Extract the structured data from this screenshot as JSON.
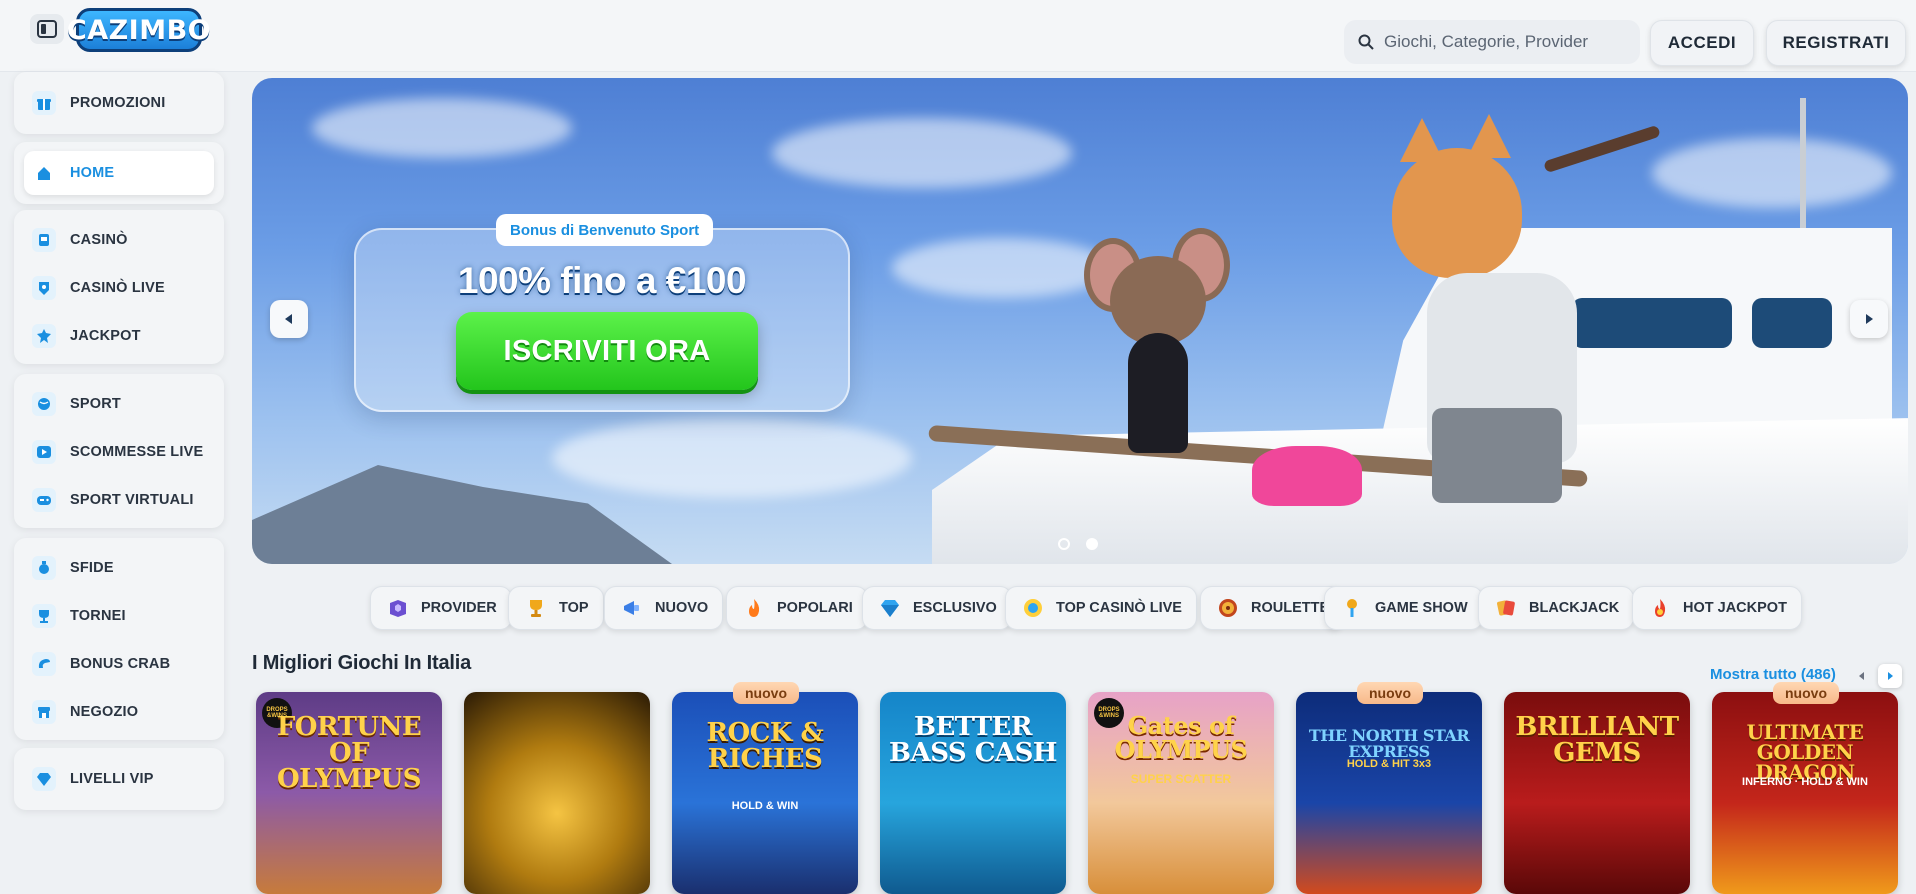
{
  "header": {
    "logo_text": "CAZIMBO",
    "search_placeholder": "Giochi, Categorie, Provider",
    "login_label": "ACCEDI",
    "register_label": "REGISTRATI"
  },
  "sidebar": {
    "groups": [
      [
        {
          "label": "PROMOZIONI",
          "icon": "gift-icon"
        }
      ],
      [
        {
          "label": "HOME",
          "icon": "home-icon",
          "active": true
        }
      ],
      [
        {
          "label": "CASINÒ",
          "icon": "slot-machine-icon"
        },
        {
          "label": "CASINÒ LIVE",
          "icon": "live-casino-icon"
        },
        {
          "label": "JACKPOT",
          "icon": "jackpot-icon"
        }
      ],
      [
        {
          "label": "SPORT",
          "icon": "ball-icon"
        },
        {
          "label": "SCOMMESSE LIVE",
          "icon": "play-icon"
        },
        {
          "label": "SPORT VIRTUALI",
          "icon": "gamepad-icon"
        }
      ],
      [
        {
          "label": "SFIDE",
          "icon": "challenge-icon"
        },
        {
          "label": "TORNEI",
          "icon": "trophy-icon"
        },
        {
          "label": "BONUS CRAB",
          "icon": "crab-icon"
        },
        {
          "label": "NEGOZIO",
          "icon": "shop-icon"
        }
      ],
      [
        {
          "label": "LIVELLI VIP",
          "icon": "diamond-icon"
        }
      ]
    ]
  },
  "hero": {
    "tag": "Bonus di Benvenuto Sport",
    "amount": "100% fino a €100",
    "cta": "ISCRIVITI ORA",
    "slides": 2,
    "active_slide": 2
  },
  "categories": [
    {
      "label": "PROVIDER",
      "icon": "provider-icon"
    },
    {
      "label": "TOP",
      "icon": "trophy-icon"
    },
    {
      "label": "NUOVO",
      "icon": "megaphone-icon"
    },
    {
      "label": "POPOLARI",
      "icon": "fire-icon"
    },
    {
      "label": "ESCLUSIVO",
      "icon": "gem-icon"
    },
    {
      "label": "TOP CASINÒ LIVE",
      "icon": "live-dealer-icon"
    },
    {
      "label": "ROULETTE",
      "icon": "roulette-icon"
    },
    {
      "label": "GAME SHOW",
      "icon": "microphone-icon"
    },
    {
      "label": "BLACKJACK",
      "icon": "cards-icon"
    },
    {
      "label": "HOT JACKPOT",
      "icon": "hot-jackpot-icon"
    }
  ],
  "games_section": {
    "title": "I Migliori Giochi In Italia",
    "see_all": "Mostra tutto (486)",
    "badge_new": "nuovo",
    "games": [
      {
        "title": "FORTUNE OF OLYMPUS",
        "new": false
      },
      {
        "title": "",
        "new": false
      },
      {
        "title": "ROCK & RICHES",
        "subtitle": "HOLD & WIN",
        "new": true
      },
      {
        "title": "BETTER BASS CASH",
        "new": false
      },
      {
        "title": "Gates of OLYMPUS",
        "subtitle": "SUPER SCATTER",
        "new": false
      },
      {
        "title": "THE NORTH STAR EXPRESS",
        "subtitle": "HOLD & HIT 3x3",
        "new": true
      },
      {
        "title": "BRILLIANT GEMS",
        "new": false
      },
      {
        "title": "ULTIMATE GOLDEN DRAGON",
        "subtitle": "INFERNO · HOLD & WIN",
        "new": true
      }
    ]
  }
}
